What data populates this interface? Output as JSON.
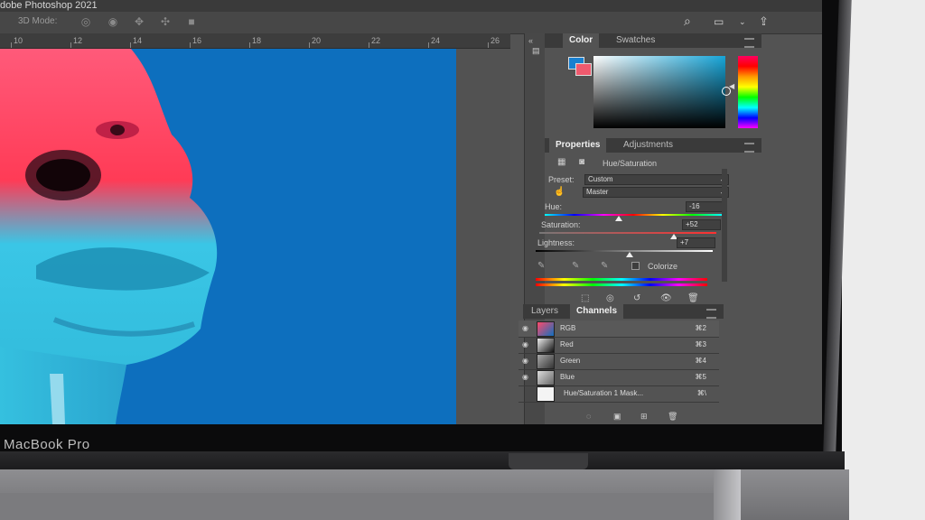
{
  "app": {
    "title": "dobe Photoshop 2021"
  },
  "options_bar": {
    "mode_label": "3D Mode:",
    "icons": [
      "3d-rotate-icon",
      "3d-roll-icon",
      "3d-pan-icon",
      "3d-slide-icon",
      "3d-camera-icon"
    ],
    "right_icons": [
      "search-icon",
      "workspace-icon",
      "share-icon"
    ]
  },
  "ruler": {
    "ticks": [
      "10",
      "12",
      "14",
      "16",
      "18",
      "20",
      "22",
      "24",
      "26"
    ]
  },
  "color_panel": {
    "tabs": [
      "Color",
      "Swatches"
    ],
    "foreground": "#1980d0",
    "background": "#f05a6e"
  },
  "properties_panel": {
    "tabs": [
      "Properties",
      "Adjustments"
    ],
    "adjustment_title": "Hue/Saturation",
    "preset_label": "Preset:",
    "preset_value": "Custom",
    "range_value": "Master",
    "hue": {
      "label": "Hue:",
      "value": "-16",
      "level": 0.42
    },
    "saturation": {
      "label": "Saturation:",
      "value": "+52",
      "level": 0.76
    },
    "lightness": {
      "label": "Lightness:",
      "value": "+7",
      "level": 0.53
    },
    "colorize_label": "Colorize"
  },
  "channels_panel": {
    "tabs": [
      "Layers",
      "Channels"
    ],
    "rows": [
      {
        "name": "RGB",
        "shortcut": "⌘2"
      },
      {
        "name": "Red",
        "shortcut": "⌘3"
      },
      {
        "name": "Green",
        "shortcut": "⌘4"
      },
      {
        "name": "Blue",
        "shortcut": "⌘5"
      },
      {
        "name": "Hue/Saturation 1 Mask...",
        "shortcut": "⌘\\"
      }
    ]
  },
  "device": {
    "brand": "MacBook Pro"
  }
}
